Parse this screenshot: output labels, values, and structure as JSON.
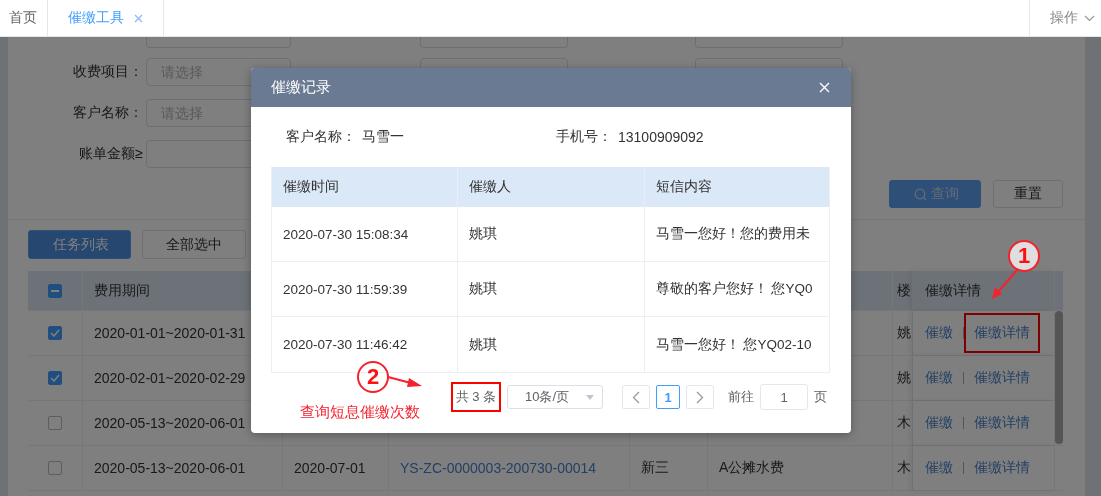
{
  "tabs": [
    {
      "label": "首页",
      "selected": false,
      "closable": false
    },
    {
      "label": "催缴工具",
      "selected": true,
      "closable": true
    }
  ],
  "tab_menu": {
    "label": "操作"
  },
  "filter_form": {
    "rows": [
      {
        "label": "收费项目：",
        "placeholder": "请选择"
      },
      {
        "label": "客户名称：",
        "placeholder": "请选择"
      },
      {
        "label": "账单金额≥"
      }
    ]
  },
  "filter_buttons": [
    {
      "label": "查询",
      "kind": "primary"
    },
    {
      "label": "重置",
      "kind": "plain"
    }
  ],
  "toolbar_buttons": [
    {
      "label": "任务列表",
      "kind": "primary"
    },
    {
      "label": "全部选中",
      "kind": "plain"
    }
  ],
  "table": {
    "header_indeterminate": true,
    "header": {
      "period": "费用期间",
      "column_6": "楼",
      "actions": "催缴详情"
    },
    "rows": [
      {
        "checked": true,
        "period": "2020-01-01~2020-01-31",
        "column_6": "姚",
        "actions": [
          "催缴",
          "催缴详情"
        ],
        "details_highlighted": true
      },
      {
        "checked": true,
        "period": "2020-02-01~2020-02-29",
        "column_6": "姚",
        "actions": [
          "催缴",
          "催缴详情"
        ],
        "details_highlighted": false
      },
      {
        "checked": false,
        "period": "2020-05-13~2020-06-01",
        "column_6": "木",
        "actions": [
          "催缴",
          "催缴详情"
        ],
        "details_highlighted": false
      },
      {
        "checked": false,
        "period": "2020-05-13~2020-06-01",
        "column_2": "2020-07-01",
        "column_3": "YS-ZC-0000003-200730-00014",
        "column_4": "新三",
        "column_5": "A公摊水费",
        "column_6": "木",
        "actions": [
          "催缴",
          "催缴详情"
        ],
        "details_highlighted": false
      }
    ]
  },
  "dialog": {
    "title": "催缴记录",
    "info": [
      {
        "label": "客户名称：",
        "value": "马雪一"
      },
      {
        "label": "手机号：",
        "value": "13100909092"
      }
    ],
    "columns": [
      "催缴时间",
      "催缴人",
      "短信内容"
    ],
    "rows": [
      [
        "2020-07-30 15:08:34",
        "姚琪",
        "马雪一您好！您的费用未"
      ],
      [
        "2020-07-30 11:59:39",
        "姚琪",
        "尊敬的客户您好！ 您YQ0"
      ],
      [
        "2020-07-30 11:46:42",
        "姚琪",
        "马雪一您好！ 您YQ02-10"
      ]
    ],
    "pagination": {
      "total": "共 3 条",
      "total_highlighted": true,
      "page_size": "10条/页",
      "pages": [
        {
          "label": "1",
          "selected": true
        }
      ],
      "jump_label": "前往",
      "jump_value": "1",
      "jump_suffix": "页"
    }
  },
  "annotations": [
    {
      "number": "1"
    },
    {
      "number": "2",
      "caption": "查询短息催缴次数"
    }
  ]
}
